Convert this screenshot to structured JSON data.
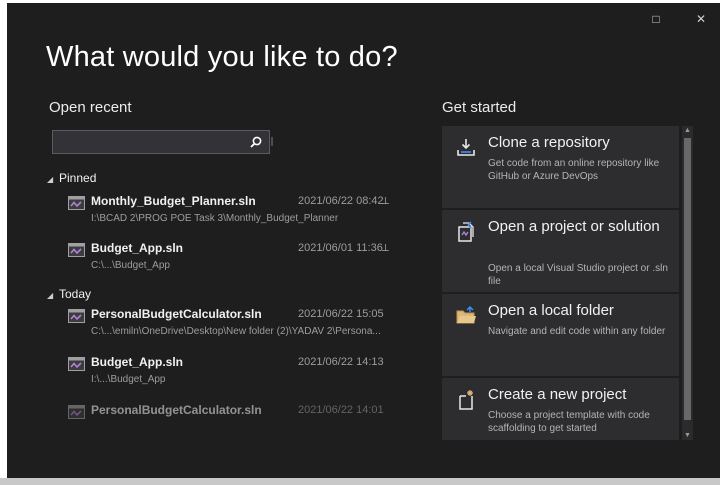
{
  "window": {
    "maximize_glyph": "□",
    "close_glyph": "✕"
  },
  "heading": "What would you like to do?",
  "open_recent": {
    "title": "Open recent",
    "search": {
      "value": "",
      "placeholder": ""
    },
    "groups": [
      {
        "label": "Pinned",
        "items": [
          {
            "name": "Monthly_Budget_Planner.sln",
            "path": "I:\\BCAD 2\\PROG POE Task 3\\Monthly_Budget_Planner",
            "date": "2021/06/22 08:42",
            "pinned": true
          },
          {
            "name": "Budget_App.sln",
            "path": "C:\\...\\Budget_App",
            "date": "2021/06/01 11:36",
            "pinned": true
          }
        ]
      },
      {
        "label": "Today",
        "items": [
          {
            "name": "PersonalBudgetCalculator.sln",
            "path": "C:\\...\\emiln\\OneDrive\\Desktop\\New folder (2)\\YADAV 2\\Persona...",
            "date": "2021/06/22 15:05",
            "pinned": false
          },
          {
            "name": "Budget_App.sln",
            "path": "I:\\...\\Budget_App",
            "date": "2021/06/22 14:13",
            "pinned": false
          },
          {
            "name": "PersonalBudgetCalculator.sln",
            "path": "",
            "date": "2021/06/22 14:01",
            "pinned": false
          }
        ]
      }
    ]
  },
  "get_started": {
    "title": "Get started",
    "cards": [
      {
        "title": "Clone a repository",
        "description": "Get code from an online repository like GitHub or Azure DevOps",
        "icon": "clone-icon"
      },
      {
        "title": "Open a project or solution",
        "description": "Open a local Visual Studio project or .sln file",
        "icon": "open-project-icon"
      },
      {
        "title": "Open a local folder",
        "description": "Navigate and edit code within any folder",
        "icon": "folder-icon"
      },
      {
        "title": "Create a new project",
        "description": "Choose a project template with code scaffolding to get started",
        "icon": "new-project-icon"
      }
    ]
  },
  "colors": {
    "background": "#1e1e1e",
    "card": "#2d2d30",
    "accent": "#68217a",
    "link_blue": "#3794ff"
  }
}
